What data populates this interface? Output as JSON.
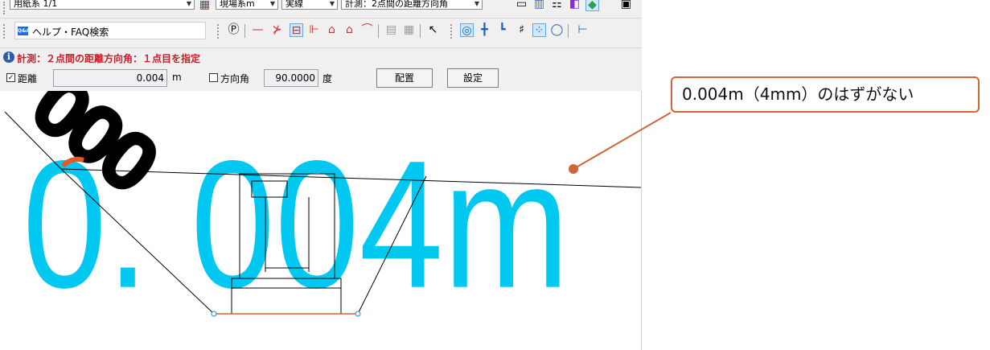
{
  "toolbar1": {
    "combo_scale": "用紙系 1/1",
    "combo_layer": "現場系m",
    "combo_mode": "実線",
    "combo_command": "計測：2点間の距離方向角"
  },
  "search": {
    "label": "ヘルプ・FAQ検索",
    "badge": "Q&A"
  },
  "status": {
    "message": "計測：２点間の距離方向角：１点目を指定"
  },
  "params": {
    "distance_label": "距離",
    "distance_checked": "✓",
    "distance_value": "0.004",
    "distance_unit": "m",
    "angle_label": "方向角",
    "angle_value": "90.0000",
    "angle_unit": "度",
    "place_button": "配置",
    "settings_button": "設定"
  },
  "canvas": {
    "measure_text": "0. 004m",
    "dim_text": "000"
  },
  "callout": {
    "text": "0.004m（4mm）のはずがない"
  },
  "colors": {
    "accent": "#d0653a",
    "measure": "#00c8f0",
    "status": "#c8202a",
    "drawing_line": "#000000",
    "base_line": "#e05a2a"
  }
}
